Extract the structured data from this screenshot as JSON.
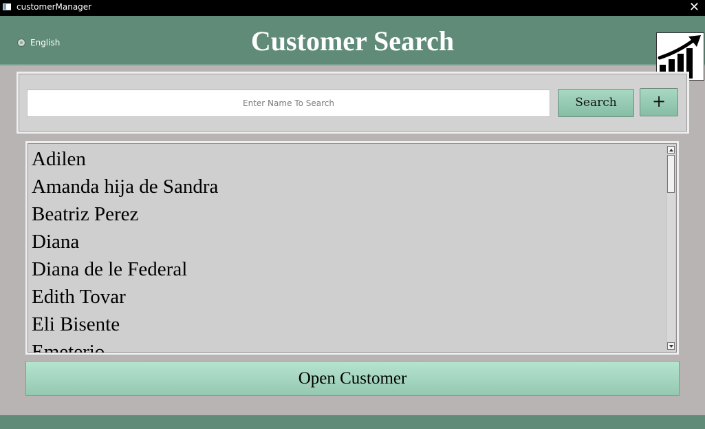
{
  "window": {
    "title": "customerManager",
    "close_glyph": "✕"
  },
  "header": {
    "language_label": "English",
    "title": "Customer Search",
    "logo_icon": "growth-chart-icon"
  },
  "search": {
    "placeholder": "Enter Name To Search",
    "value": "",
    "search_label": "Search",
    "add_label": "+"
  },
  "customers": [
    "Adilen",
    "Amanda hija de Sandra",
    "Beatriz Perez",
    "Diana",
    "Diana de le Federal",
    "Edith Tovar",
    "Eli Bisente",
    "Emeterio"
  ],
  "actions": {
    "open_label": "Open Customer"
  },
  "colors": {
    "header": "#5f8b78",
    "background": "#b8b4b4",
    "button": "#a8d8c2"
  }
}
